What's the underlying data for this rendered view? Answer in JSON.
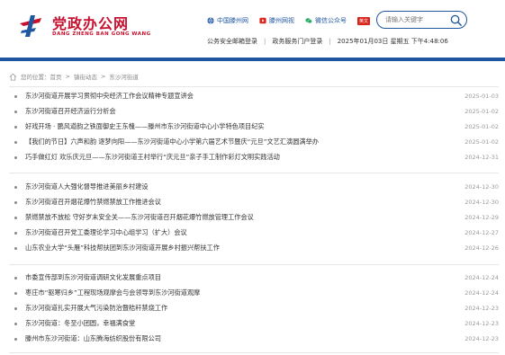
{
  "header": {
    "logo_title": "党政办公网",
    "logo_sub": "DANG ZHENG BAN GONG WANG",
    "top_links": [
      {
        "label": "中国滕州网",
        "icon": "globe-icon"
      },
      {
        "label": "滕州网视",
        "icon": "play-icon"
      },
      {
        "label": "微信公众号",
        "icon": "wechat-icon"
      }
    ],
    "lang_badge": "英文",
    "search_placeholder": "请输入关键字",
    "sub_links": [
      "公务安全邮箱登录",
      "政务服务门户登录"
    ],
    "datetime": "2025年01月03日 星期五 下午4:48:06"
  },
  "breadcrumb": {
    "label": "您的位置：",
    "items": [
      "首页",
      "镇街动态",
      "东沙河街道"
    ]
  },
  "groups": [
    {
      "items": [
        {
          "title": "东沙河街道开展学习贯彻中央经济工作会议精神专题宣讲会",
          "date": "2025-01-03"
        },
        {
          "title": "东沙河街道召开经济运行分析会",
          "date": "2025-01-02"
        },
        {
          "title": "好戏开场 · 鹏风遒韵之铁面御史王东槐——滕州市东沙河街道中心小学特色项目纪实",
          "date": "2025-01-02"
        },
        {
          "title": "【我们的节日】六声和韵 逐梦向阳——东沙河街道中心小学第六届艺术节暨庆“元旦”文艺汇演圆满举办",
          "date": "2025-01-02"
        },
        {
          "title": "巧手做红灯 欢乐庆元旦——东沙河街道王村举行“庆元旦”亲子手工制作彩灯文明实践活动",
          "date": "2024-12-31"
        }
      ]
    },
    {
      "items": [
        {
          "title": "东沙河街道人大强化督导推进美丽乡村建设",
          "date": "2024-12-30"
        },
        {
          "title": "东沙河街道召开烟花爆竹禁燃禁放工作推进会议",
          "date": "2024-12-30"
        },
        {
          "title": "禁燃禁放不放松 守好岁末安全关——东沙河街道召开烟花爆竹燃放管理工作会议",
          "date": "2024-12-29"
        },
        {
          "title": "东沙河街道召开党工委理论学习中心组学习（扩大）会议",
          "date": "2024-12-27"
        },
        {
          "title": "山东农业大学“头雁”科技帮扶团到东沙河街道开展乡村振兴帮扶工作",
          "date": "2024-12-26"
        }
      ]
    },
    {
      "items": [
        {
          "title": "市委宣传部到东沙河街道调研文化发展重点项目",
          "date": "2024-12-24"
        },
        {
          "title": "枣庄市“驱寒归乡”工程现场观摩会与会领导到东沙河街道观摩",
          "date": "2024-12-24"
        },
        {
          "title": "东沙河街道扎实开展大气污染防治暨秸秆禁烧工作",
          "date": "2024-12-23"
        },
        {
          "title": "东沙河街道：冬至小团圆，幸福满食堂",
          "date": "2024-12-23"
        },
        {
          "title": "滕州市东沙河街道：山东腾海纺织股份有限公司",
          "date": "2024-12-23"
        }
      ]
    }
  ],
  "colors": {
    "brand_red": "#c8102e",
    "brand_blue": "#1e56a0"
  }
}
